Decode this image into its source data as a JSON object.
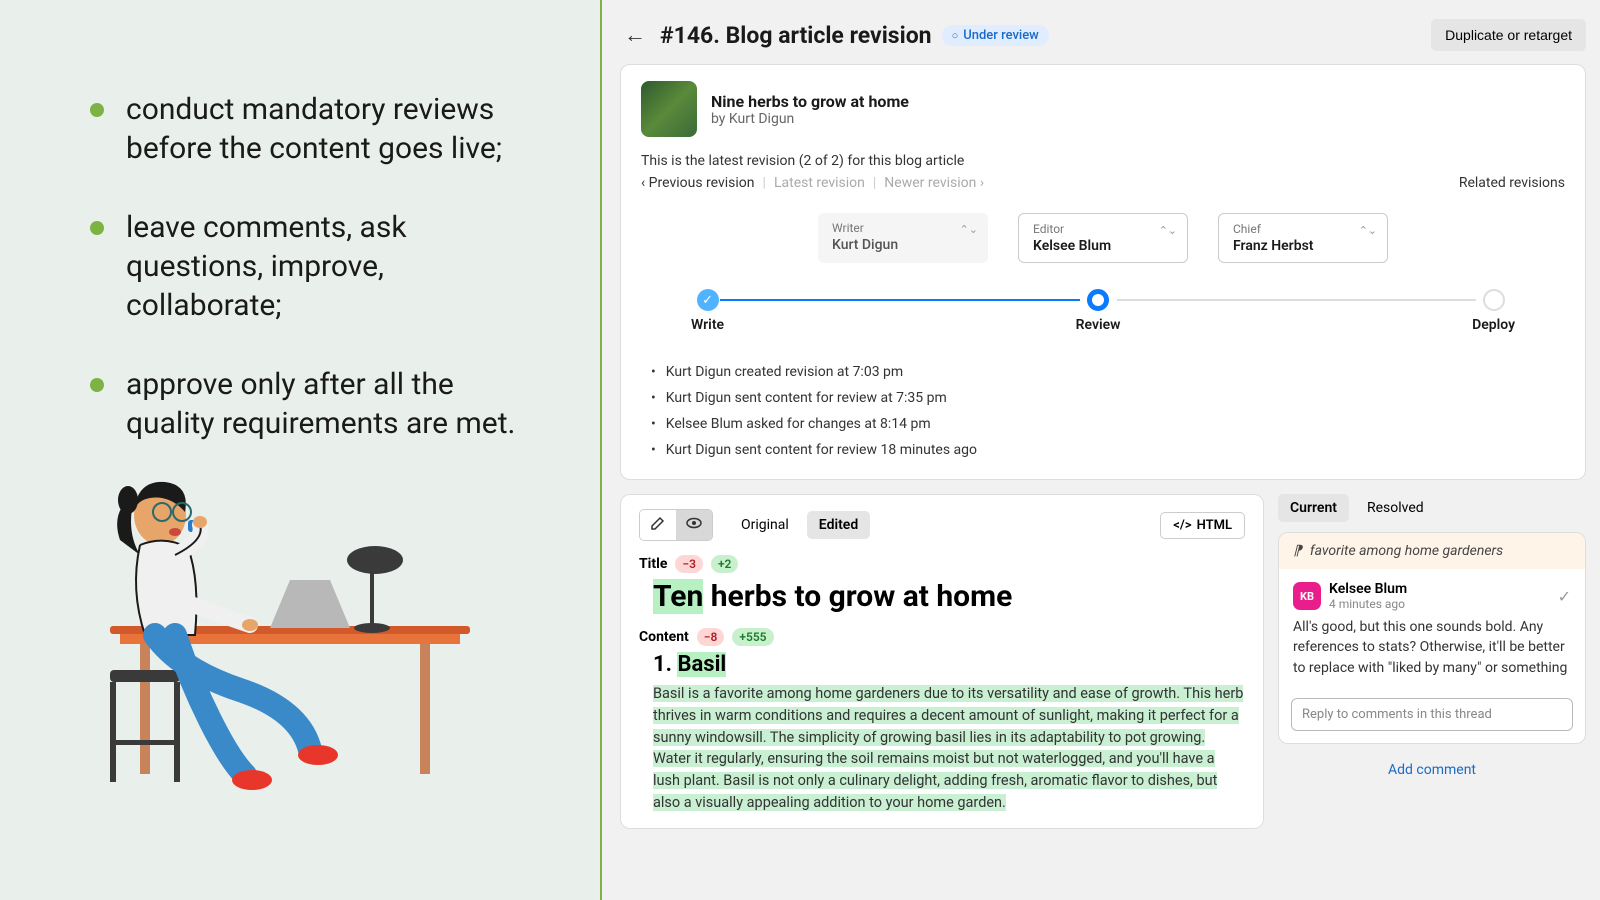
{
  "left": {
    "bullets": [
      "conduct mandatory reviews before the content goes live;",
      "leave comments, ask questions, improve, collaborate;",
      "approve only after all the quality requirements are met."
    ]
  },
  "header": {
    "title": "#146. Blog article revision",
    "status": "Under review",
    "duplicate_btn": "Duplicate or retarget"
  },
  "article": {
    "title": "Nine herbs to grow at home",
    "byline": "by Kurt Digun"
  },
  "revision": {
    "info": "This is the latest revision (2 of 2) for this blog article",
    "prev": "‹ Previous revision",
    "latest": "Latest revision",
    "newer": "Newer revision ›",
    "related": "Related revisions"
  },
  "roles": {
    "writer": {
      "label": "Writer",
      "name": "Kurt Digun"
    },
    "editor": {
      "label": "Editor",
      "name": "Kelsee Blum"
    },
    "chief": {
      "label": "Chief",
      "name": "Franz Herbst"
    }
  },
  "steps": {
    "write": "Write",
    "review": "Review",
    "deploy": "Deploy"
  },
  "activity": [
    "Kurt Digun created revision at 7:03 pm",
    "Kurt Digun sent content for review at 7:35 pm",
    "Kelsee Blum asked for changes at 8:14 pm",
    "Kurt Digun sent content for review 18 minutes ago"
  ],
  "content": {
    "tabs": {
      "original": "Original",
      "edited": "Edited"
    },
    "html_btn": "HTML",
    "title_label": "Title",
    "title_diff_minus": "−3",
    "title_diff_plus": "+2",
    "doc_title_hl": "Ten",
    "doc_title_rest": " herbs to grow at home",
    "content_label": "Content",
    "content_diff_minus": "−8",
    "content_diff_plus": "+555",
    "section_num": "1. ",
    "section_hl": "Basil",
    "body": "Basil is a favorite among home gardeners due to its versatility and ease of growth. This herb thrives in warm conditions and requires a decent amount of sunlight, making it perfect for a sunny windowsill. The simplicity of growing basil lies in its adaptability to pot growing. Water it regularly, ensuring the soil remains moist but not waterlogged, and you'll have a lush plant. Basil is not only a culinary delight, adding fresh, aromatic flavor to dishes, but also a visually appealing addition to your home garden."
  },
  "comments": {
    "tabs": {
      "current": "Current",
      "resolved": "Resolved"
    },
    "thread_ref": "favorite among home gardeners",
    "author": "Kelsee Blum",
    "author_initials": "KB",
    "time": "4 minutes ago",
    "body": "All's good, but this one sounds bold. Any references to stats? Otherwise, it'll be better to replace with \"liked by many\" or something",
    "reply_placeholder": "Reply to comments in this thread",
    "add": "Add comment"
  }
}
